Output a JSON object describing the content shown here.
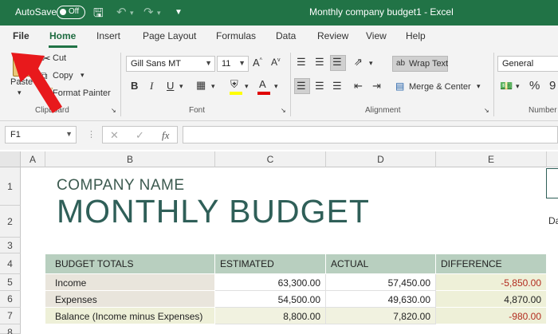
{
  "titlebar": {
    "autosave_label": "AutoSave",
    "autosave_state": "Off",
    "title": "Monthly company budget1  -  Excel",
    "accent": "#217346"
  },
  "tabs": [
    "File",
    "Home",
    "Insert",
    "Page Layout",
    "Formulas",
    "Data",
    "Review",
    "View",
    "Help"
  ],
  "ribbon": {
    "clipboard": {
      "paste": "Paste",
      "cut": "Cut",
      "copy": "Copy",
      "format_painter": "Format Painter",
      "group": "Clipboard"
    },
    "font": {
      "name": "Gill Sans MT",
      "size": "11",
      "bold": "B",
      "italic": "I",
      "underline": "U",
      "font_color_letter": "A",
      "group": "Font"
    },
    "alignment": {
      "wrap_text": "Wrap Text",
      "merge_center": "Merge & Center",
      "group": "Alignment"
    },
    "number": {
      "format": "General",
      "percent": "%",
      "group": "Number"
    }
  },
  "formula_bar": {
    "name_box": "F1",
    "fx": "fx",
    "cancel": "✕",
    "enter": "✓"
  },
  "columns": [
    "A",
    "B",
    "C",
    "D",
    "E"
  ],
  "rows": [
    "1",
    "2",
    "3",
    "4",
    "5",
    "6",
    "7",
    "8"
  ],
  "sheet": {
    "company_name": "COMPANY NAME",
    "title": "MONTHLY BUDGET",
    "date_label": "Da",
    "table": {
      "headers": [
        "BUDGET TOTALS",
        "ESTIMATED",
        "ACTUAL",
        "DIFFERENCE"
      ],
      "rows": [
        {
          "label": "Income",
          "estimated": "63,300.00",
          "actual": "57,450.00",
          "difference": "-5,850.00"
        },
        {
          "label": "Expenses",
          "estimated": "54,500.00",
          "actual": "49,630.00",
          "difference": "4,870.00"
        },
        {
          "label": "Balance (Income minus Expenses)",
          "estimated": "8,800.00",
          "actual": "7,820.00",
          "difference": "-980.00"
        }
      ]
    }
  }
}
